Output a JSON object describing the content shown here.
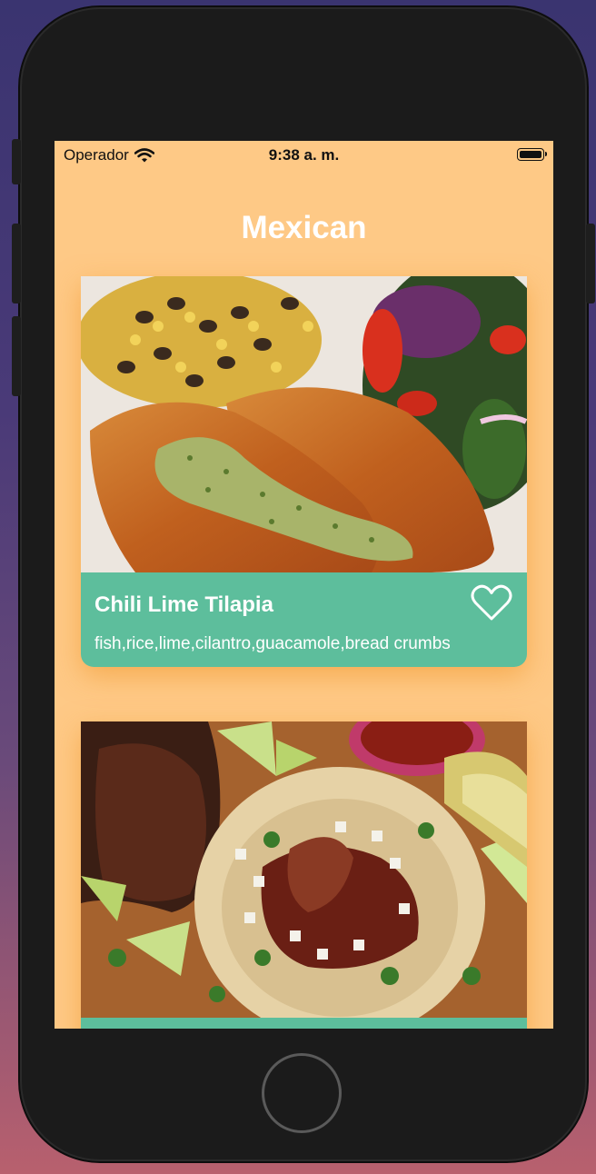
{
  "status_bar": {
    "carrier": "Operador",
    "time": "9:38 a. m."
  },
  "page": {
    "title": "Mexican"
  },
  "recipes": [
    {
      "name": "Chili Lime Tilapia",
      "ingredients": "fish,rice,lime,cilantro,guacamole,bread crumbs",
      "image": "tilapia-photo",
      "favorite_icon": "heart-outline-icon"
    },
    {
      "name": "",
      "ingredients": "",
      "image": "steak-taco-photo"
    }
  ],
  "colors": {
    "screen_background": "#fec986",
    "card_footer": "#5dbe9c",
    "title_text": "#ffffff"
  }
}
